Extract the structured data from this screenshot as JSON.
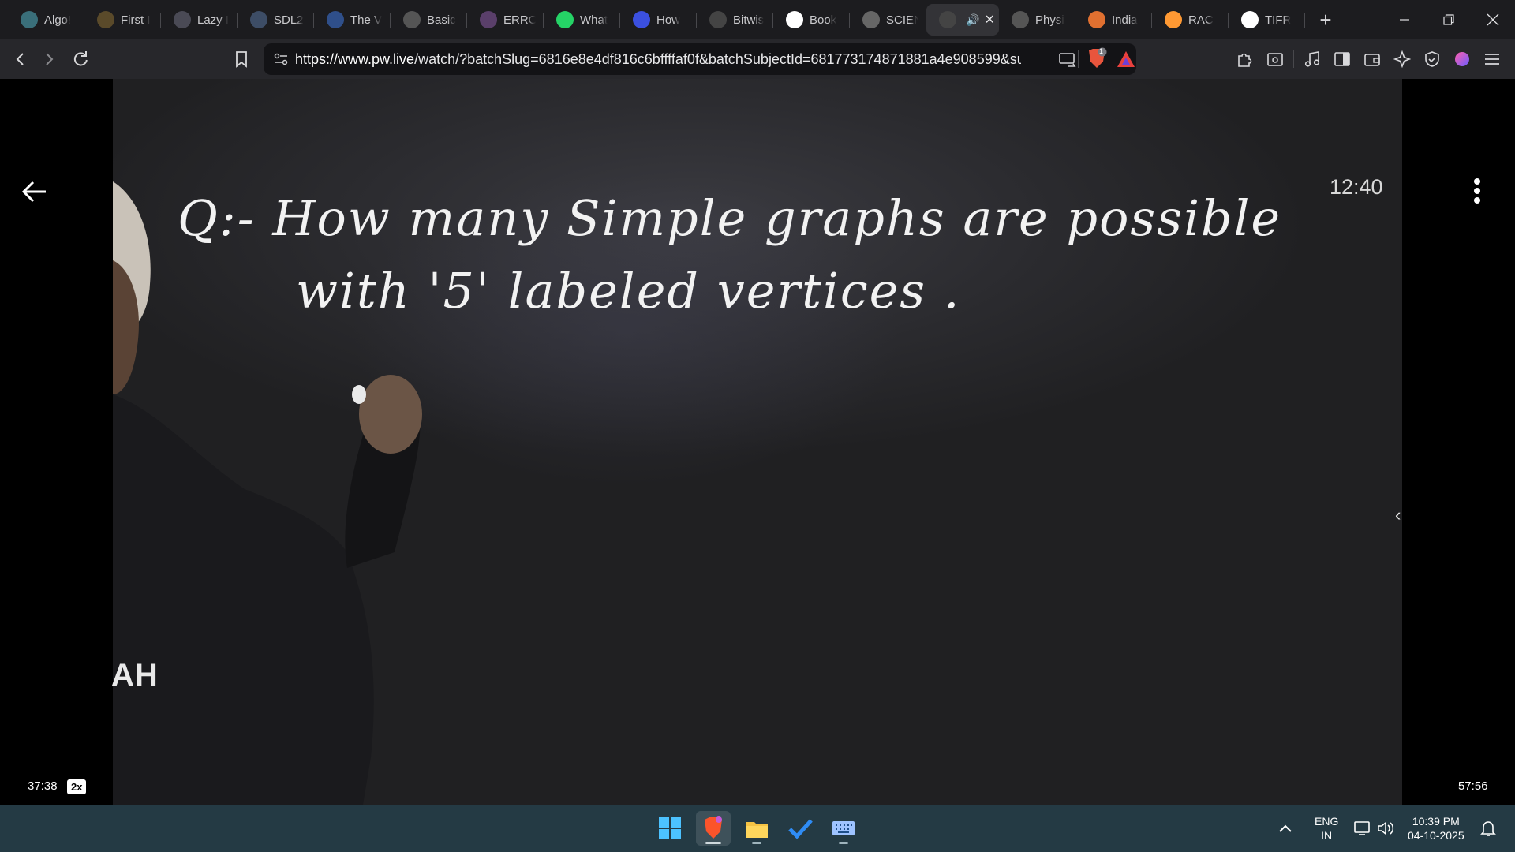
{
  "browser": {
    "tabs": [
      {
        "label": "Algo!",
        "icon": "algo-icon",
        "color": "#3a6f7a"
      },
      {
        "label": "First I",
        "icon": "first-icon",
        "color": "#5a4a2a"
      },
      {
        "label": "Lazy I",
        "icon": "lazy-icon",
        "color": "#4a4a55"
      },
      {
        "label": "SDL2",
        "icon": "sdl-icon",
        "color": "#3d4d66"
      },
      {
        "label": "The V",
        "icon": "w3-icon",
        "color": "#2f4f8a"
      },
      {
        "label": "Basic",
        "icon": "html-icon",
        "color": "#555"
      },
      {
        "label": "ERRO",
        "icon": "erro-icon",
        "color": "#5a3f6a"
      },
      {
        "label": "What",
        "icon": "whatsapp-icon",
        "color": "#25d366"
      },
      {
        "label": "How",
        "icon": "how-icon",
        "color": "#3b50e0"
      },
      {
        "label": "Bitwis",
        "icon": "gfg-icon",
        "color": "#444"
      },
      {
        "label": "Book",
        "icon": "google-icon",
        "color": "#ffffff"
      },
      {
        "label": "SCIEN",
        "icon": "scien-icon",
        "color": "#666"
      },
      {
        "label": "",
        "icon": "pw-icon",
        "color": "#444",
        "active": true
      },
      {
        "label": "Physi",
        "icon": "physi-icon",
        "color": "#555"
      },
      {
        "label": "India",
        "icon": "india-icon",
        "color": "#e07030"
      },
      {
        "label": "RAC",
        "icon": "flag-icon",
        "color": "#ff9933"
      },
      {
        "label": "TIFR",
        "icon": "google-icon",
        "color": "#ffffff"
      }
    ],
    "new_tab": "+",
    "url_host": "https://www.pw.live",
    "url_path": "/watch/?batchSlug=6816e8e4df816c6bffffaf0f&batchSubjectId=681773174871881a4e908599&su...",
    "shields_count": "1"
  },
  "video": {
    "board_text_line1": "Q:-  How  many  Simple  graphs  are  possible",
    "board_text_line2": "with  '5'  labeled  vertices .",
    "clock": "12:40",
    "watermark": "AH",
    "current_time": "37:38",
    "speed": "2x",
    "total_time": "57:56",
    "played_fraction": 0.6496,
    "buffered_fraction": 0.6726,
    "accent": "#5b4ff0",
    "skip_seconds": "10"
  },
  "taskbar": {
    "lang_top": "ENG",
    "lang_bottom": "IN",
    "time": "10:39 PM",
    "date": "04-10-2025"
  }
}
